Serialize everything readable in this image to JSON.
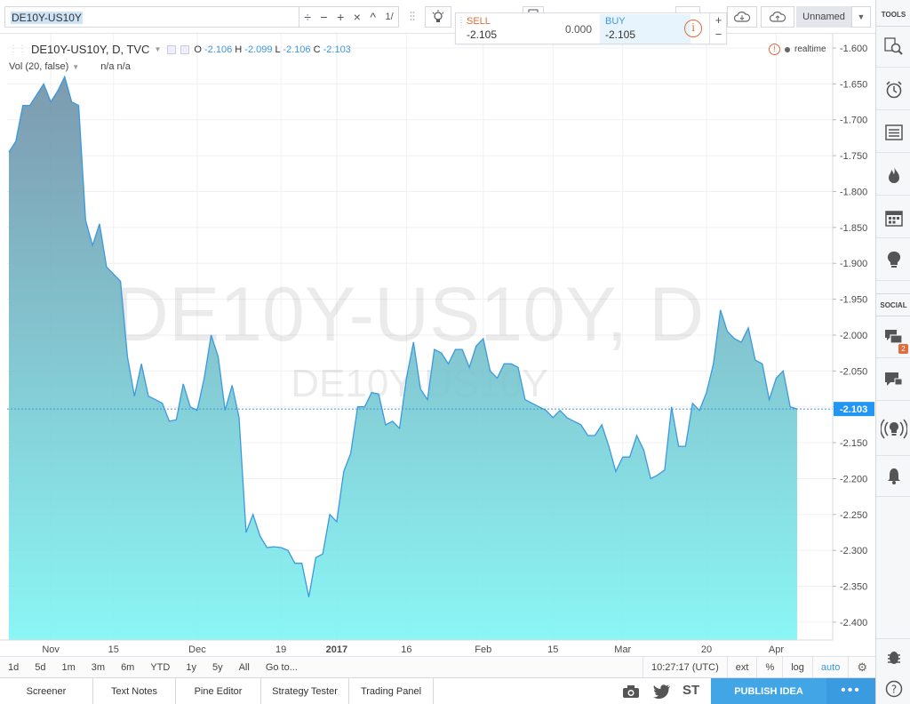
{
  "toolbar": {
    "symbol": "DE10Y-US10Y",
    "ops": [
      "÷",
      "−",
      "+",
      "×",
      "^",
      "1/"
    ],
    "unnamed_label": "Unnamed"
  },
  "trade": {
    "sell_label": "SELL",
    "sell_value": "-2.105",
    "spread": "0.000",
    "buy_label": "BUY",
    "buy_value": "-2.105",
    "info": "i",
    "plus": "+",
    "minus": "−"
  },
  "legend": {
    "title": "DE10Y-US10Y, D, TVC",
    "o_label": "O",
    "o": "-2.106",
    "h_label": "H",
    "h": "-2.099",
    "l_label": "L",
    "l": "-2.106",
    "c_label": "C",
    "c": "-2.103",
    "vol": "Vol (20, false)",
    "vol_values": "n/a n/a",
    "realtime": "realtime"
  },
  "watermark": {
    "big": "DE10Y-US10Y, D",
    "small": "DE10Y-US10Y"
  },
  "colors": {
    "line": "#3b99e0",
    "fill_top": "#6f8fa6",
    "fill_bottom": "#7ef5f4",
    "last_badge": "#2196f3",
    "accent_orange": "#e06b3c",
    "publish": "#42a5e5"
  },
  "sidebar": {
    "tools_label": "TOOLS",
    "social_label": "SOCIAL",
    "chat_badge": "2",
    "icons": [
      "search-icon",
      "alarm-icon",
      "watchlist-icon",
      "hotlist-icon",
      "calendar-icon",
      "ideas-icon",
      "chat-icon",
      "private-chat-icon",
      "streams-icon",
      "notifications-icon",
      "bug-icon",
      "help-icon"
    ]
  },
  "timeframes": [
    "1d",
    "5d",
    "1m",
    "3m",
    "6m",
    "YTD",
    "1y",
    "5y",
    "All",
    "Go to..."
  ],
  "timebar_right": {
    "clock": "10:27:17 (UTC)",
    "ext": "ext",
    "pct": "%",
    "log": "log",
    "auto": "auto"
  },
  "bottom_tabs": [
    "Screener",
    "Text Notes",
    "Pine Editor",
    "Strategy Tester",
    "Trading Panel"
  ],
  "bottom_right": {
    "st": "ST",
    "publish": "PUBLISH IDEA",
    "more": "•••"
  },
  "chart_data": {
    "type": "area",
    "ylim": [
      -2.41,
      -1.6
    ],
    "yticks": [
      -1.6,
      -1.65,
      -1.7,
      -1.75,
      -1.8,
      -1.85,
      -1.9,
      -1.95,
      -2.0,
      -2.05,
      -2.1,
      -2.15,
      -2.2,
      -2.25,
      -2.3,
      -2.35,
      -2.4
    ],
    "ytick_labels": [
      "-1.600",
      "-1.650",
      "-1.700",
      "-1.750",
      "-1.800",
      "-1.850",
      "-1.900",
      "-1.950",
      "-2.000",
      "-2.050",
      "-2.100",
      "-2.150",
      "-2.200",
      "-2.250",
      "-2.300",
      "-2.350",
      "-2.400"
    ],
    "xticks": [
      {
        "label": "Nov",
        "i": 6
      },
      {
        "label": "15",
        "i": 15
      },
      {
        "label": "Dec",
        "i": 27
      },
      {
        "label": "19",
        "i": 39
      },
      {
        "label": "2017",
        "i": 47
      },
      {
        "label": "16",
        "i": 57
      },
      {
        "label": "Feb",
        "i": 68
      },
      {
        "label": "15",
        "i": 78
      },
      {
        "label": "Mar",
        "i": 88
      },
      {
        "label": "20",
        "i": 100
      },
      {
        "label": "Apr",
        "i": 110
      }
    ],
    "last_value": -2.103,
    "last_label": "-2.103",
    "values": [
      -1.745,
      -1.73,
      -1.68,
      -1.68,
      -1.665,
      -1.65,
      -1.675,
      -1.66,
      -1.64,
      -1.675,
      -1.68,
      -1.84,
      -1.875,
      -1.845,
      -1.905,
      -1.915,
      -1.925,
      -2.03,
      -2.085,
      -2.04,
      -2.085,
      -2.09,
      -2.095,
      -2.12,
      -2.118,
      -2.068,
      -2.1,
      -2.105,
      -2.06,
      -2.0,
      -2.03,
      -2.105,
      -2.07,
      -2.115,
      -2.275,
      -2.25,
      -2.28,
      -2.296,
      -2.295,
      -2.296,
      -2.3,
      -2.318,
      -2.318,
      -2.365,
      -2.31,
      -2.305,
      -2.25,
      -2.26,
      -2.19,
      -2.165,
      -2.1,
      -2.1,
      -2.08,
      -2.082,
      -2.125,
      -2.12,
      -2.13,
      -2.06,
      -2.01,
      -2.075,
      -2.09,
      -2.02,
      -2.025,
      -2.04,
      -2.02,
      -2.02,
      -2.045,
      -2.015,
      -2.005,
      -2.05,
      -2.06,
      -2.04,
      -2.04,
      -2.045,
      -2.09,
      -2.095,
      -2.1,
      -2.105,
      -2.115,
      -2.105,
      -2.115,
      -2.12,
      -2.125,
      -2.14,
      -2.14,
      -2.125,
      -2.155,
      -2.19,
      -2.17,
      -2.17,
      -2.14,
      -2.16,
      -2.2,
      -2.195,
      -2.188,
      -2.1,
      -2.155,
      -2.155,
      -2.095,
      -2.105,
      -2.08,
      -2.04,
      -1.965,
      -1.995,
      -2.005,
      -2.01,
      -1.99,
      -2.035,
      -2.04,
      -2.09,
      -2.06,
      -2.05,
      -2.1,
      -2.103
    ]
  }
}
